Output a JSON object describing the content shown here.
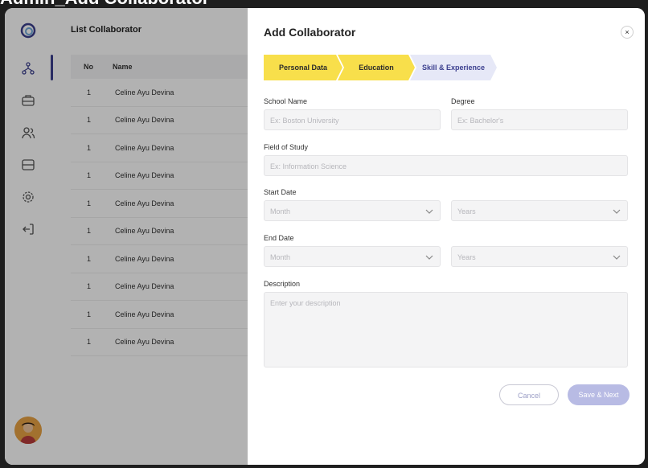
{
  "window": {
    "title": "Admin_Add Collaborator"
  },
  "sidebar": {
    "items": [
      {
        "icon": "network-icon",
        "active": true
      },
      {
        "icon": "briefcase-icon",
        "active": false
      },
      {
        "icon": "users-icon",
        "active": false
      },
      {
        "icon": "layers-icon",
        "active": false
      },
      {
        "icon": "gear-icon",
        "active": false
      },
      {
        "icon": "logout-icon",
        "active": false
      }
    ]
  },
  "list": {
    "title": "List Collaborator",
    "columns": [
      "No",
      "Name"
    ],
    "rows": [
      {
        "no": "1",
        "name": "Celine Ayu Devina"
      },
      {
        "no": "1",
        "name": "Celine Ayu Devina"
      },
      {
        "no": "1",
        "name": "Celine Ayu Devina"
      },
      {
        "no": "1",
        "name": "Celine Ayu Devina"
      },
      {
        "no": "1",
        "name": "Celine Ayu Devina"
      },
      {
        "no": "1",
        "name": "Celine Ayu Devina"
      },
      {
        "no": "1",
        "name": "Celine Ayu Devina"
      },
      {
        "no": "1",
        "name": "Celine Ayu Devina"
      },
      {
        "no": "1",
        "name": "Celine Ayu Devina"
      },
      {
        "no": "1",
        "name": "Celine Ayu Devina"
      }
    ]
  },
  "modal": {
    "title": "Add Collaborator",
    "close_symbol": "×",
    "steps": [
      {
        "label": "Personal Data",
        "state": "done"
      },
      {
        "label": "Education",
        "state": "done"
      },
      {
        "label": "Skill & Experience",
        "state": "current"
      }
    ],
    "form": {
      "school_label": "School Name",
      "school_placeholder": "Ex: Boston University",
      "degree_label": "Degree",
      "degree_placeholder": "Ex: Bachelor's",
      "field_label": "Field of Study",
      "field_placeholder": "Ex: Information Science",
      "start_label": "Start Date",
      "start_month": "Month",
      "start_year": "Years",
      "end_label": "End Date",
      "end_month": "Month",
      "end_year": "Years",
      "description_label": "Description",
      "description_placeholder": "Enter your description"
    },
    "buttons": {
      "cancel": "Cancel",
      "save": "Save & Next"
    }
  },
  "colors": {
    "step_done": "#f8df4b",
    "step_current": "#e6e8f7",
    "primary": "#3b3f8f",
    "save_button": "#b8bbe4"
  }
}
